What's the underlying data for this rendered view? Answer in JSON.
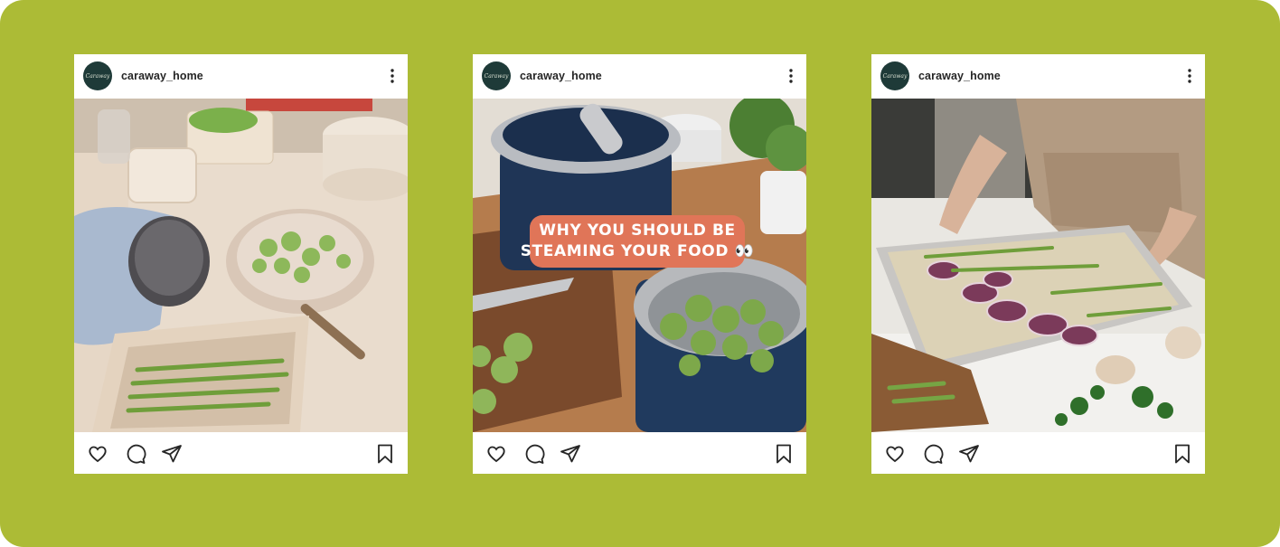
{
  "colors": {
    "background": "#acbb36",
    "card": "#ffffff",
    "avatar": "#1e3a38",
    "overlay_pill": "#e07558"
  },
  "posts": [
    {
      "username": "caraway_home",
      "avatar_text": "Caraway",
      "photo": "cookware-spread-with-brussels-sprouts-and-asparagus",
      "icons": [
        "heart-icon",
        "comment-icon",
        "share-icon",
        "bookmark-icon",
        "more-icon"
      ]
    },
    {
      "username": "caraway_home",
      "avatar_text": "Caraway",
      "photo": "navy-steamer-pot-with-brussels-sprouts",
      "overlay_line1": "WHY YOU SHOULD BE",
      "overlay_line2": "STEAMING YOUR FOOD 👀",
      "icons": [
        "heart-icon",
        "comment-icon",
        "share-icon",
        "bookmark-icon",
        "more-icon"
      ]
    },
    {
      "username": "caraway_home",
      "avatar_text": "Caraway",
      "photo": "sheet-pan-focaccia-with-onions-and-asparagus",
      "icons": [
        "heart-icon",
        "comment-icon",
        "share-icon",
        "bookmark-icon",
        "more-icon"
      ]
    }
  ]
}
